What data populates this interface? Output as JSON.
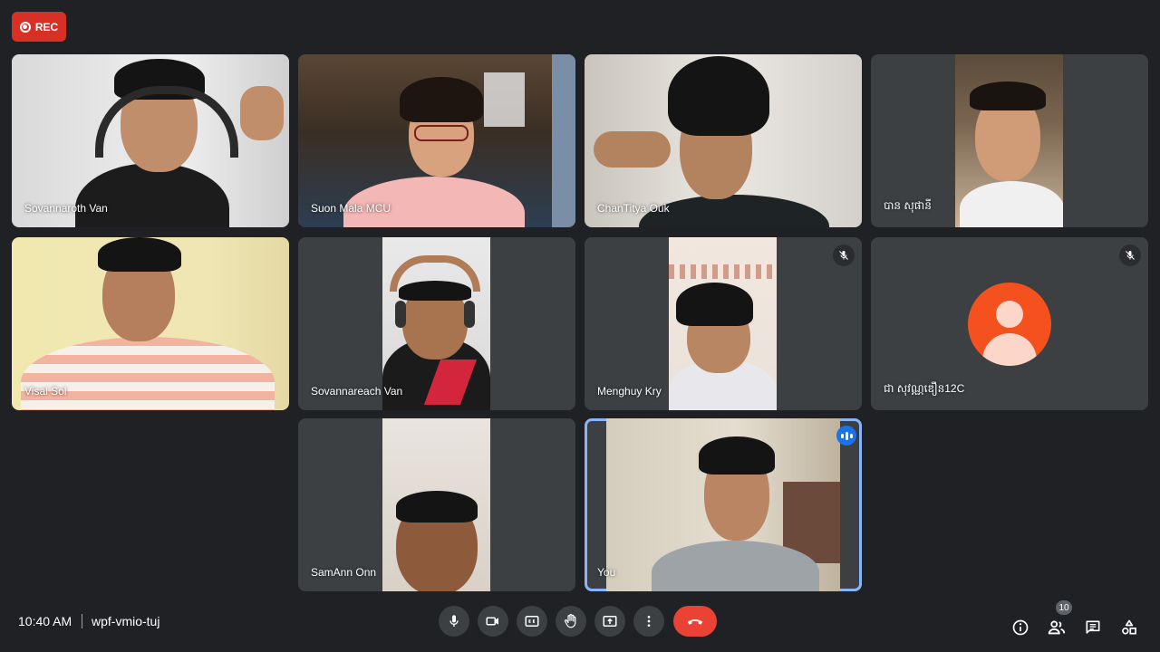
{
  "recording": {
    "label": "REC"
  },
  "participants": [
    {
      "name": "Sovannaroth Van"
    },
    {
      "name": "Suon Mala MCU"
    },
    {
      "name": "ChanTitya Ouk"
    },
    {
      "name": "បាន សុផានី"
    },
    {
      "name": "Visal Sol"
    },
    {
      "name": "Sovannareach Van"
    },
    {
      "name": "Menghuy Kry",
      "muted": true
    },
    {
      "name": "ជា សុវណ្ណឌឿន12C",
      "muted": true
    },
    {
      "name": "SamAnn Onn"
    },
    {
      "name": "You",
      "speaking": true
    }
  ],
  "meeting": {
    "time": "10:40 AM",
    "code": "wpf-vmio-tuj"
  },
  "controls": {
    "items": [
      "microphone",
      "camera",
      "captions",
      "raise-hand",
      "present",
      "more-options",
      "leave-call"
    ]
  },
  "right_controls": {
    "people_count": "10"
  },
  "colors": {
    "background": "#202124",
    "tile": "#3c4043",
    "accent": "#1a73e8",
    "danger": "#ea4335",
    "avatar": "#f4511e"
  }
}
